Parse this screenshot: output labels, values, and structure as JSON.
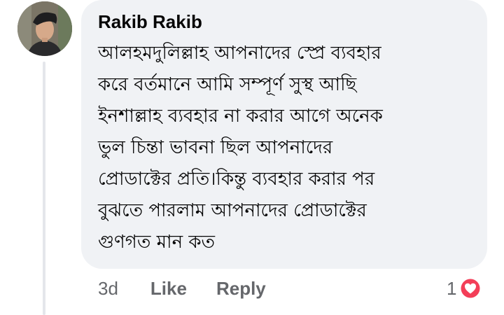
{
  "comment": {
    "author": "Rakib Rakib",
    "text": "আলহমদুলিল্লাহ আপনাদের স্প্রে ব্যবহার\nকরে বর্তমানে আমি সম্পূর্ণ সুস্থ আছি\nইনশাল্লাহ ব্যবহার না করার আগে অনেক\nভুল চিন্তা ভাবনা ছিল আপনাদের\nপ্রোডাক্টের প্রতি।কিন্তু ব্যবহার করার পর\nবুঝতে পারলাম আপনাদের প্রোডাক্টের\nগুণগত মান কত",
    "timestamp": "3d",
    "like_label": "Like",
    "reply_label": "Reply",
    "reaction_count": "1",
    "reaction_icon": "heart-icon"
  },
  "colors": {
    "bubble_bg": "#f0f2f5",
    "secondary_text": "#65676b",
    "heart": "#f33e58"
  }
}
